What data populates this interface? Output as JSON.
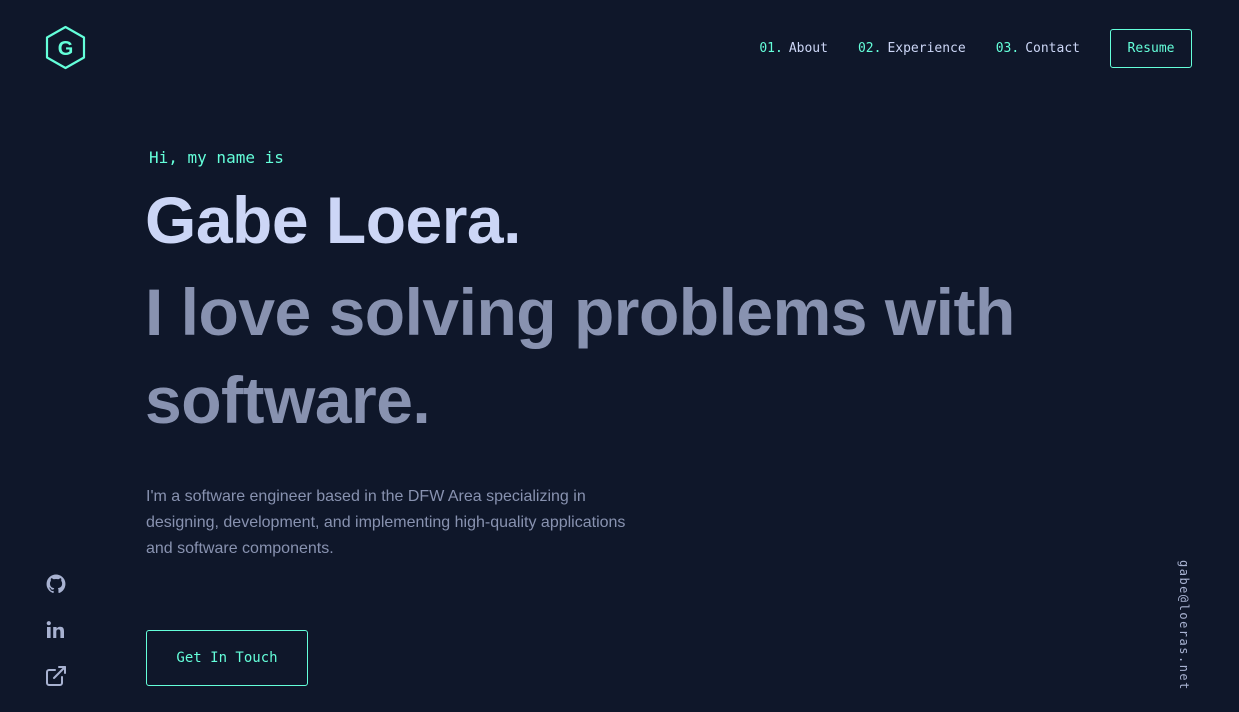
{
  "header": {
    "logo_letter": "G",
    "nav": [
      {
        "num": "01.",
        "label": "About"
      },
      {
        "num": "02.",
        "label": "Experience"
      },
      {
        "num": "03.",
        "label": "Contact"
      }
    ],
    "resume_label": "Resume"
  },
  "hero": {
    "intro": "Hi, my name is",
    "name": "Gabe Loera.",
    "tagline": "I love solving problems with software.",
    "bio": "I'm a software engineer based in the DFW Area specializing in designing, development, and implementing high-quality applications and software components.",
    "cta_label": "Get In Touch"
  },
  "social": {
    "icons": [
      "github-icon",
      "linkedin-icon",
      "external-link-icon"
    ]
  },
  "email": "gabe@loeras.net",
  "colors": {
    "background": "#0f172a",
    "accent": "#64ffda",
    "heading": "#ccd6f6",
    "text": "#8892b0"
  }
}
